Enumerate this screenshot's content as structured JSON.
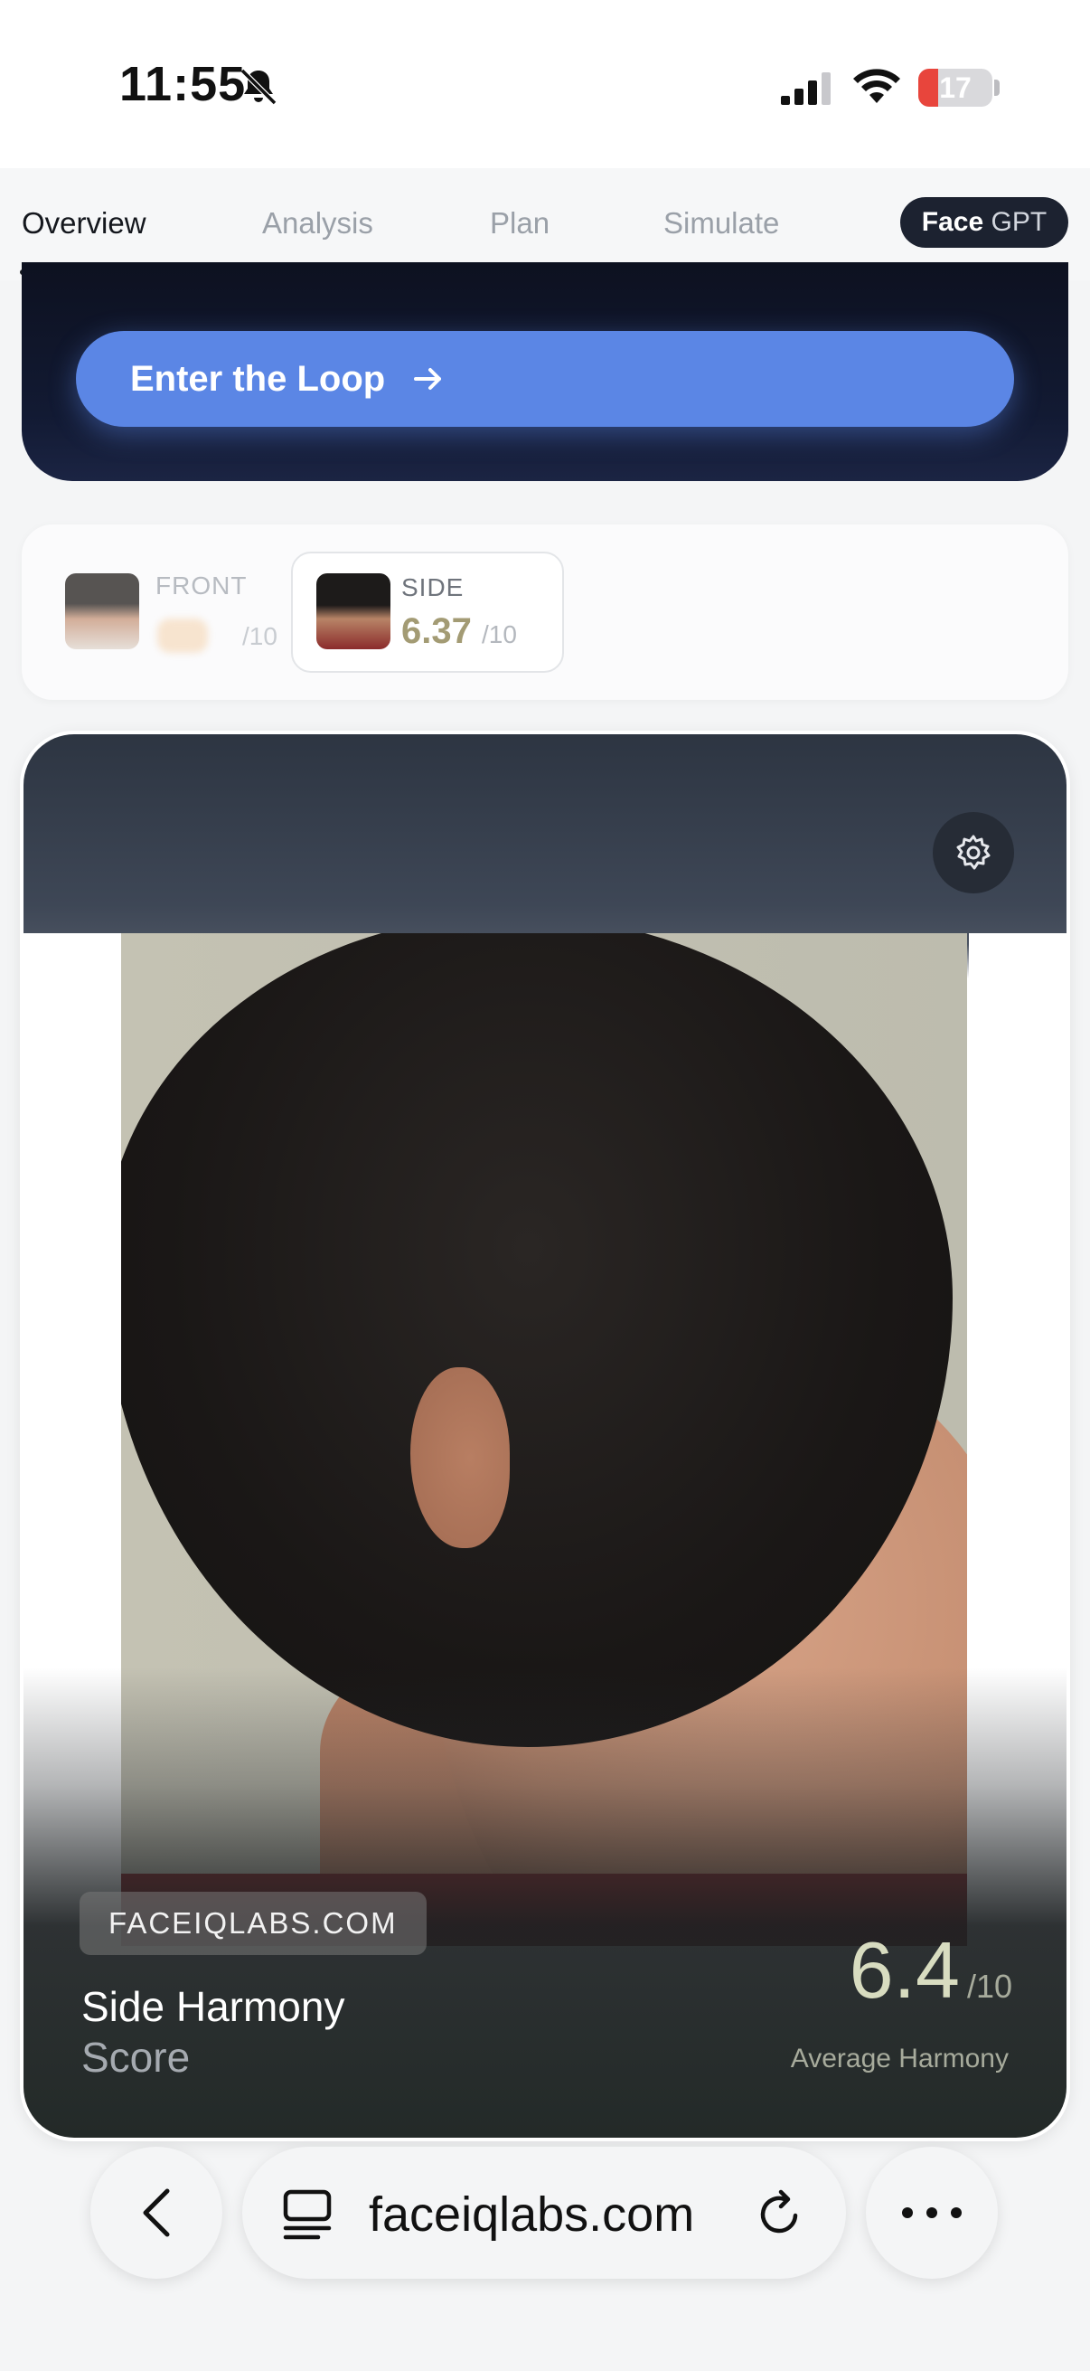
{
  "status_bar": {
    "time": "11:55",
    "battery": "17"
  },
  "tabs": {
    "items": [
      {
        "label": "Overview"
      },
      {
        "label": "Analysis"
      },
      {
        "label": "Plan"
      },
      {
        "label": "Simulate"
      }
    ],
    "active": "Overview",
    "face_gpt_bold": "Face",
    "face_gpt_light": "GPT"
  },
  "loop_card": {
    "button_label": "Enter the Loop"
  },
  "selector": {
    "front": {
      "label": "FRONT",
      "max": "/10"
    },
    "side": {
      "label": "SIDE",
      "score": "6.37",
      "max": "/10"
    }
  },
  "photo_card": {
    "domain_badge": "FACEIQLABS.COM",
    "title": "Side Harmony",
    "subtitle": "Score",
    "score": "6.4",
    "score_max": "/10",
    "score_caption": "Average Harmony"
  },
  "browser": {
    "url": "faceiqlabs.com"
  },
  "colors": {
    "accent": "#5b86e5",
    "dark_card": "#0d1120",
    "score_gold": "#a39b74"
  },
  "icons": [
    "bell-slash-icon",
    "signal-icon",
    "wifi-icon",
    "battery-icon",
    "arrow-right-icon",
    "gear-icon",
    "chevron-left-icon",
    "tabs-icon",
    "reload-icon",
    "more-dots-icon"
  ]
}
